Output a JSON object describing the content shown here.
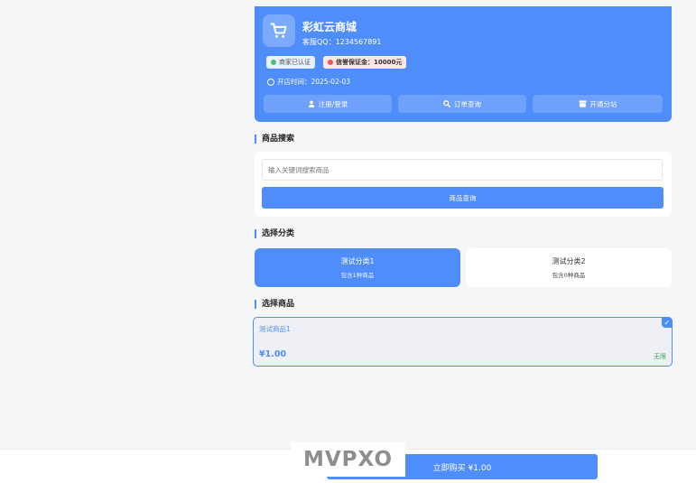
{
  "store": {
    "name": "彩虹云商城",
    "qq": "客服QQ：1234567891",
    "badge_verified": "商家已认证",
    "badge_deposit": "信誉保证金：10000元",
    "open_time": "开店时间：2025-02-03",
    "actions": {
      "login": "注册/登录",
      "order_query": "订单查询",
      "open_branch": "开通分站"
    }
  },
  "search": {
    "title": "商品搜索",
    "placeholder": "输入关键词搜索商品",
    "button": "商品查询"
  },
  "categories": {
    "title": "选择分类",
    "items": [
      {
        "name": "测试分类1",
        "count": "包含1种商品"
      },
      {
        "name": "测试分类2",
        "count": "包含0种商品"
      }
    ]
  },
  "products": {
    "title": "选择商品",
    "items": [
      {
        "name": "测试商品1",
        "price": "¥1.00",
        "stock": "无限"
      }
    ]
  },
  "checkout": {
    "buy_button": "立即购买 ¥1.00"
  },
  "watermark": "MVPXO",
  "colors": {
    "accent": "#4f8dfb",
    "page_bg": "#f5f6f8",
    "stock_green": "#3aa95a",
    "verified_dot": "#45c56b",
    "deposit_dot": "#ee5555"
  },
  "icons": [
    "cart-icon",
    "user-icon",
    "search-icon",
    "shop-icon",
    "clock-icon",
    "check-icon"
  ]
}
